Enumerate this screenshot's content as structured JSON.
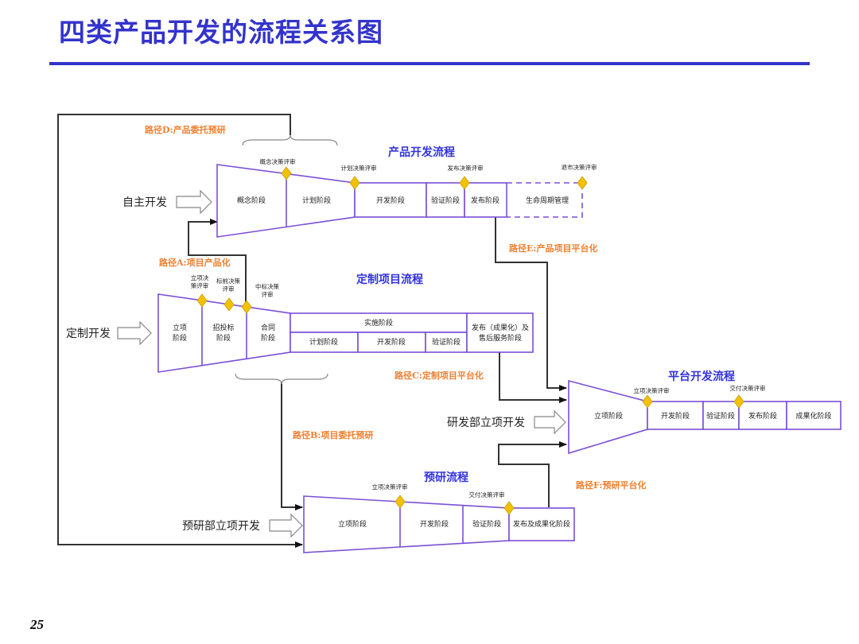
{
  "page": {
    "title": "四类产品开发的流程关系图",
    "page_number": "25"
  },
  "colors": {
    "title": "#3333cc",
    "stage_border": "#7b4fd6",
    "gate": "#f2c200",
    "path_label": "#f08030",
    "flow_label": "#3333dd",
    "connector": "#333333"
  },
  "flows": {
    "product": {
      "label": "产品开发流程",
      "entry": "自主开发",
      "stages": [
        "概念阶段",
        "计划阶段",
        "开发阶段",
        "验证阶段",
        "发布阶段",
        "生命周期管理"
      ],
      "gates": [
        "概念决策评审",
        "计划决策评审",
        "发布决策评审",
        "退市决策评审"
      ]
    },
    "custom": {
      "label": "定制项目流程",
      "entry": "定制开发",
      "stages": [
        "立项\n阶段",
        "招投标\n阶段",
        "合同\n阶段"
      ],
      "stage_lines": [
        [
          "立项",
          "阶段"
        ],
        [
          "招投标",
          "阶段"
        ],
        [
          "合同",
          "阶段"
        ]
      ],
      "implementation": {
        "label": "实施阶段",
        "substages": [
          "计划阶段",
          "开发阶段",
          "验证阶段"
        ]
      },
      "release": [
        "发布（成果化）及",
        "售后服务阶段"
      ],
      "gates": [
        [
          "立项决",
          "策评审"
        ],
        [
          "标前决策",
          "评审"
        ],
        [
          "中标决策",
          "评审"
        ]
      ]
    },
    "platform": {
      "label": "平台开发流程",
      "entry": "研发部立项开发",
      "stages": [
        "立项阶段",
        "开发阶段",
        "验证阶段",
        "发布阶段",
        "成果化阶段"
      ],
      "gates": [
        "立项决策评审",
        "交付决策评审"
      ]
    },
    "research": {
      "label": "预研流程",
      "entry": "预研部立项开发",
      "stages": [
        "立项阶段",
        "开发阶段",
        "验证阶段",
        "发布及成果化阶段"
      ],
      "gates": [
        "立项决策评审",
        "交付决策评审"
      ]
    }
  },
  "paths": {
    "A": "路径A:项目产品化",
    "B": "路径B:项目委托预研",
    "C": "路径C:定制项目平台化",
    "D": "路径D:产品委托预研",
    "E": "路径E:产品项目平台化",
    "F": "路径F:预研平台化"
  }
}
